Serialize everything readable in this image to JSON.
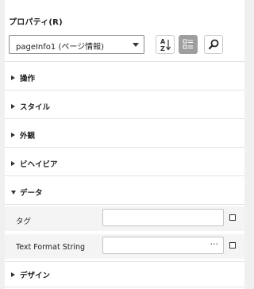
{
  "panel": {
    "title": "プロパティ(R)",
    "object_selector": {
      "value": "pageInfo1 (ページ情報)"
    },
    "toolbar": [
      {
        "name": "sort-alphabetical-icon",
        "active": false
      },
      {
        "name": "categorized-view-icon",
        "active": true
      },
      {
        "name": "search-icon",
        "active": false
      }
    ]
  },
  "categories": [
    {
      "label": "操作",
      "expanded": false
    },
    {
      "label": "スタイル",
      "expanded": false
    },
    {
      "label": "外観",
      "expanded": false
    },
    {
      "label": "ビヘイビア",
      "expanded": false
    },
    {
      "label": "データ",
      "expanded": true
    },
    {
      "label": "デザイン",
      "expanded": false
    }
  ],
  "data_properties": [
    {
      "label": "タグ",
      "value": "",
      "has_ellipsis": false
    },
    {
      "label": "Text Format String",
      "value": "",
      "has_ellipsis": true,
      "ellipsis": "···"
    }
  ]
}
